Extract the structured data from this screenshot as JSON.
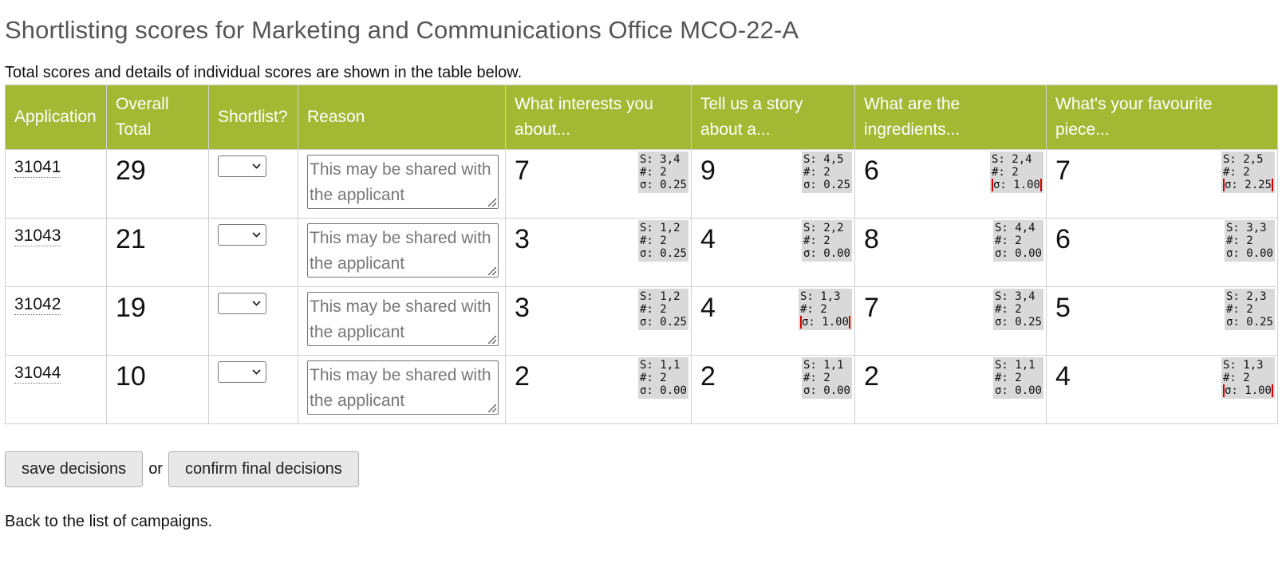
{
  "page": {
    "title": "Shortlisting scores for Marketing and Communications Office MCO-22-A",
    "intro": "Total scores and details of individual scores are shown in the table below."
  },
  "table": {
    "headers": {
      "application": "Application",
      "overall_total": "Overall Total",
      "shortlist": "Shortlist?",
      "reason": "Reason",
      "q1": "What interests you about...",
      "q2": "Tell us a story about a...",
      "q3": "What are the ingredients...",
      "q4": "What's your favourite piece..."
    },
    "reason_placeholder": "This may be shared with the applicant",
    "select_icon": "chevron-down-icon",
    "rows": [
      {
        "id": "31041",
        "total": "29",
        "scores": [
          {
            "value": "7",
            "s": "S: 3,4",
            "n": "#: 2",
            "sigma": "σ: 0.25",
            "flag": false
          },
          {
            "value": "9",
            "s": "S: 4,5",
            "n": "#: 2",
            "sigma": "σ: 0.25",
            "flag": false
          },
          {
            "value": "6",
            "s": "S: 2,4",
            "n": "#: 2",
            "sigma": "σ: 1.00",
            "flag": true
          },
          {
            "value": "7",
            "s": "S: 2,5",
            "n": "#: 2",
            "sigma": "σ: 2.25",
            "flag": true
          }
        ]
      },
      {
        "id": "31043",
        "total": "21",
        "scores": [
          {
            "value": "3",
            "s": "S: 1,2",
            "n": "#: 2",
            "sigma": "σ: 0.25",
            "flag": false
          },
          {
            "value": "4",
            "s": "S: 2,2",
            "n": "#: 2",
            "sigma": "σ: 0.00",
            "flag": false
          },
          {
            "value": "8",
            "s": "S: 4,4",
            "n": "#: 2",
            "sigma": "σ: 0.00",
            "flag": false
          },
          {
            "value": "6",
            "s": "S: 3,3",
            "n": "#: 2",
            "sigma": "σ: 0.00",
            "flag": false
          }
        ]
      },
      {
        "id": "31042",
        "total": "19",
        "scores": [
          {
            "value": "3",
            "s": "S: 1,2",
            "n": "#: 2",
            "sigma": "σ: 0.25",
            "flag": false
          },
          {
            "value": "4",
            "s": "S: 1,3",
            "n": "#: 2",
            "sigma": "σ: 1.00",
            "flag": true
          },
          {
            "value": "7",
            "s": "S: 3,4",
            "n": "#: 2",
            "sigma": "σ: 0.25",
            "flag": false
          },
          {
            "value": "5",
            "s": "S: 2,3",
            "n": "#: 2",
            "sigma": "σ: 0.25",
            "flag": false
          }
        ]
      },
      {
        "id": "31044",
        "total": "10",
        "scores": [
          {
            "value": "2",
            "s": "S: 1,1",
            "n": "#: 2",
            "sigma": "σ: 0.00",
            "flag": false
          },
          {
            "value": "2",
            "s": "S: 1,1",
            "n": "#: 2",
            "sigma": "σ: 0.00",
            "flag": false
          },
          {
            "value": "2",
            "s": "S: 1,1",
            "n": "#: 2",
            "sigma": "σ: 0.00",
            "flag": false
          },
          {
            "value": "4",
            "s": "S: 1,3",
            "n": "#: 2",
            "sigma": "σ: 1.00",
            "flag": true
          }
        ]
      }
    ]
  },
  "actions": {
    "save_label": "save decisions",
    "or_label": "or",
    "confirm_label": "confirm final decisions"
  },
  "footer": {
    "back_link": "Back to the list of campaigns."
  },
  "colors": {
    "header_bg": "#a3b933",
    "flag_border": "#d40000",
    "stats_bg": "#d9d9d9"
  }
}
